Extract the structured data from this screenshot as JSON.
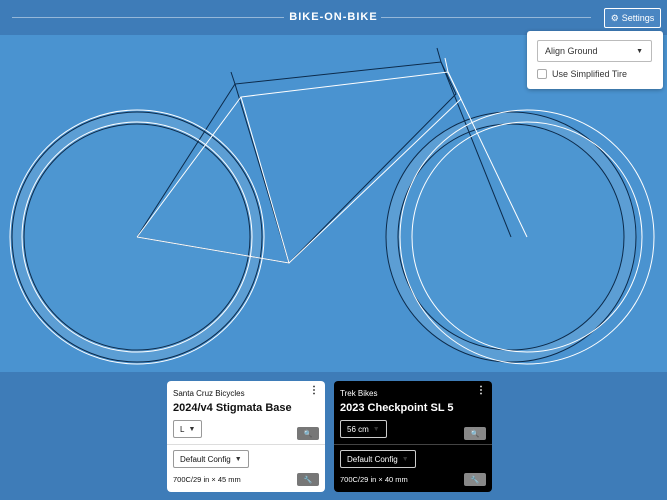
{
  "app": {
    "title": "BIKE-ON-BIKE"
  },
  "header": {
    "settings_label": "Settings",
    "settings_icon": "gear-icon"
  },
  "settings_panel": {
    "align_select": {
      "selected": "Align Ground"
    },
    "simplified_tire": {
      "label": "Use Simplified Tire",
      "checked": false
    }
  },
  "colors": {
    "background": "#4a93d0",
    "header": "#3e7cb8",
    "bike_a": "#0c2a4a",
    "bike_b": "#ffffff"
  },
  "bikes": [
    {
      "brand": "Santa Cruz Bicycles",
      "model": "2024/v4 Stigmata Base",
      "size": "L",
      "config": "Default Config",
      "tire": "700C/29 in × 45 mm",
      "theme": "light"
    },
    {
      "brand": "Trek Bikes",
      "model": "2023 Checkpoint SL 5",
      "size": "56 cm",
      "config": "Default Config",
      "tire": "700C/29 in × 40 mm",
      "theme": "dark"
    }
  ]
}
